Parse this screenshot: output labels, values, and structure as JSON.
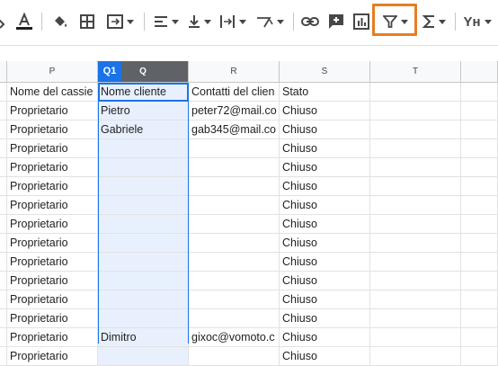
{
  "toolbar": {
    "items": [
      {
        "name": "fill-color-icon"
      },
      {
        "name": "text-color-icon"
      },
      {
        "name": "highlight-color-icon"
      },
      {
        "name": "borders-icon"
      },
      {
        "name": "merge-cells-icon"
      },
      {
        "name": "horizontal-align-icon"
      },
      {
        "name": "vertical-align-icon"
      },
      {
        "name": "text-wrap-icon"
      },
      {
        "name": "text-rotation-icon"
      },
      {
        "name": "insert-link-icon"
      },
      {
        "name": "insert-comment-icon"
      },
      {
        "name": "insert-chart-icon"
      },
      {
        "name": "filter-icon"
      },
      {
        "name": "functions-icon"
      },
      {
        "name": "input-tools-icon"
      }
    ],
    "input_tools_label": "Yʜ"
  },
  "name_box": "Q1",
  "columns": [
    {
      "id": "col-o",
      "label": ""
    },
    {
      "id": "col-p",
      "label": "P"
    },
    {
      "id": "col-q",
      "label": "Q"
    },
    {
      "id": "col-r",
      "label": "R"
    },
    {
      "id": "col-s",
      "label": "S"
    },
    {
      "id": "col-t",
      "label": "T"
    },
    {
      "id": "col-u",
      "label": ""
    }
  ],
  "rows": [
    {
      "p": "Nome del cassie",
      "q": "Nome cliente",
      "r": "Contatti del clien",
      "s": "Stato"
    },
    {
      "p": "Proprietario",
      "q": "Pietro",
      "r": "peter72@mail.co",
      "s": "Chiuso"
    },
    {
      "p": "Proprietario",
      "q": "Gabriele",
      "r": "gab345@mail.co",
      "s": "Chiuso"
    },
    {
      "p": "Proprietario",
      "q": "",
      "r": "",
      "s": "Chiuso"
    },
    {
      "p": "Proprietario",
      "q": "",
      "r": "",
      "s": "Chiuso"
    },
    {
      "p": "Proprietario",
      "q": "",
      "r": "",
      "s": "Chiuso"
    },
    {
      "p": "Proprietario",
      "q": "",
      "r": "",
      "s": "Chiuso"
    },
    {
      "p": "Proprietario",
      "q": "",
      "r": "",
      "s": "Chiuso"
    },
    {
      "p": "Proprietario",
      "q": "",
      "r": "",
      "s": "Chiuso"
    },
    {
      "p": "Proprietario",
      "q": "",
      "r": "",
      "s": "Chiuso"
    },
    {
      "p": "Proprietario",
      "q": "",
      "r": "",
      "s": "Chiuso"
    },
    {
      "p": "Proprietario",
      "q": "",
      "r": "",
      "s": "Chiuso"
    },
    {
      "p": "Proprietario",
      "q": "",
      "r": "",
      "s": "Chiuso"
    },
    {
      "p": "Proprietario",
      "q": "Dimitro",
      "r": "gixoc@vomoto.c",
      "s": "Chiuso"
    },
    {
      "p": "Proprietario",
      "q": "",
      "r": "",
      "s": "Chiuso"
    }
  ],
  "colors": {
    "selection_blue": "#1a73e8",
    "selection_fill": "#e8f0fe",
    "highlight_orange": "#e67e22"
  }
}
